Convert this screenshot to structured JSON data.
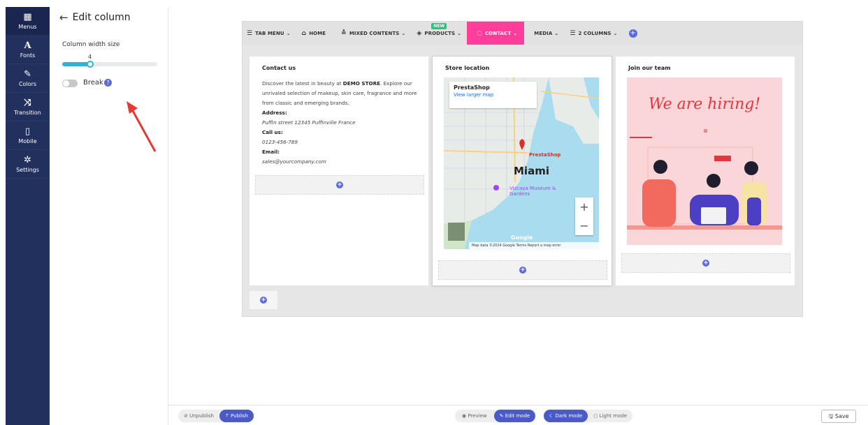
{
  "rail": {
    "items": [
      {
        "icon": "▦",
        "label": "Menus"
      },
      {
        "icon": "A",
        "label": "Fonts"
      },
      {
        "icon": "✎",
        "label": "Colors"
      },
      {
        "icon": "⤨",
        "label": "Transition"
      },
      {
        "icon": "▯",
        "label": "Mobile"
      },
      {
        "icon": "✲",
        "label": "Settings"
      }
    ]
  },
  "panel": {
    "title": "Edit column",
    "width_label": "Column width size",
    "width_value": "4",
    "width_fraction": 0.3,
    "break_label": "Break",
    "break_help": "?",
    "break_on": false
  },
  "menubar": {
    "items": [
      {
        "icon": "☰",
        "label": "TAB MENU",
        "caret": true
      },
      {
        "icon": "⌂",
        "label": "HOME",
        "caret": false
      },
      {
        "icon": "≛",
        "label": "MIXED CONTENTS",
        "caret": true
      },
      {
        "icon": "◈",
        "label": "PRODUCTS",
        "caret": true,
        "badge": "NEW"
      },
      {
        "icon": "◌",
        "label": "CONTACT",
        "caret": true
      },
      {
        "icon": "",
        "label": "MEDIA",
        "caret": true
      },
      {
        "icon": "☰",
        "label": "2 COLUMNS",
        "caret": true
      }
    ],
    "active_color": "#ff3d9b"
  },
  "contact": {
    "title": "Contact us",
    "intro_a": "Discover the latest in beauty at ",
    "intro_b": "DEMO STORE",
    "intro_c": ". Explore our unrivaled selection of makeup, skin care, fragrance and more from classic and emerging brands.",
    "address_label": "Address:",
    "address": "Puffin street 12345 Puffinville France",
    "call_label": "Call us:",
    "phone": "0123-456-789",
    "email_label": "Email:",
    "email": "sales@yourcompany.com"
  },
  "store": {
    "title": "Store location",
    "map_card_title": "PrestaShop",
    "map_card_link": "View larger map",
    "city": "Miami",
    "pin_label": "PrestaShop",
    "poi": "Vizcaya Museum & Gardens",
    "attribution": "Map data ©2024 Google   Terms   Report a map error",
    "google": "Google"
  },
  "team": {
    "title": "Join our team",
    "hiring_text": "We are hiring!"
  },
  "bottom": {
    "unpublish": "Unpublish",
    "publish": "Publish",
    "preview": "Preview",
    "edit_mode": "Edit mode",
    "dark_mode": "Dark mode",
    "light_mode": "Light mode",
    "save": "Save"
  },
  "colors": {
    "rail": "#22305e",
    "accent": "#4a5bc9",
    "slider": "#2fb1d9"
  }
}
